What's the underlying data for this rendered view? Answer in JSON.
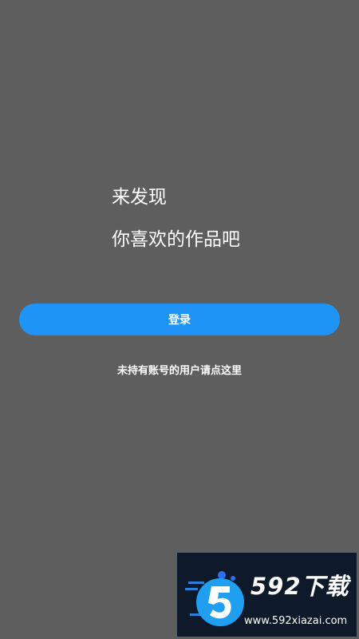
{
  "headline": {
    "line1": "来发现",
    "line2": "你喜欢的作品吧"
  },
  "login": {
    "label": "登录"
  },
  "register_link": {
    "label": "未持有账号的用户请点这里"
  },
  "watermark": {
    "logo_icon": "592-logo-icon",
    "brand": "592下载",
    "url": "www.592xiazai.com"
  },
  "colors": {
    "background": "#5e5e5e",
    "accent": "#1e95f6",
    "text": "#ffffff",
    "watermark_bg": "#0e1a2a"
  }
}
